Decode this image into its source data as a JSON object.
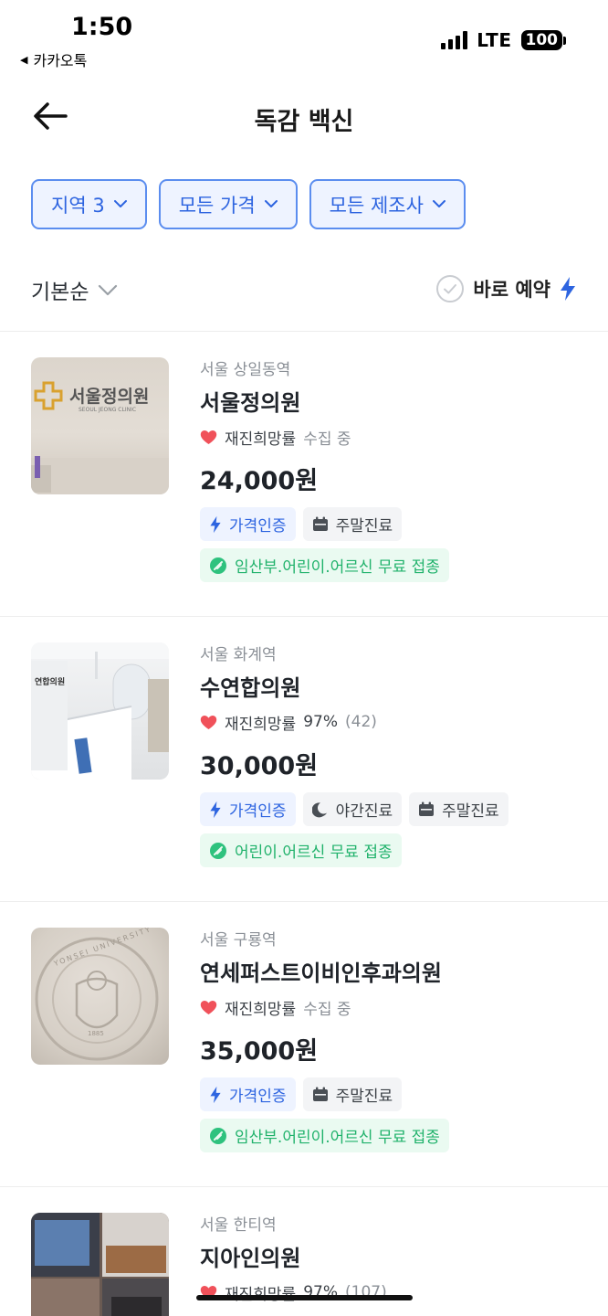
{
  "status": {
    "time": "1:50",
    "back_app": "카카오톡",
    "network": "LTE",
    "battery": "100"
  },
  "header": {
    "title": "독감 백신"
  },
  "filters": [
    {
      "label": "지역 3"
    },
    {
      "label": "모든 가격"
    },
    {
      "label": "모든 제조사"
    }
  ],
  "sort": {
    "label": "기본순",
    "instant_booking": "바로 예약"
  },
  "listings": [
    {
      "location": "서울 상일동역",
      "name": "서울정의원",
      "rating_label": "재진희망률",
      "rating_value": "수집 중",
      "rating_count": "",
      "price": "24,000원",
      "tags": [
        "가격인증",
        "주말진료"
      ],
      "free_tag": "임산부.어린이.어르신 무료 접종",
      "thumb_text": "서울정의원",
      "thumb_sub": "SEOUL JEONG CLINIC"
    },
    {
      "location": "서울 화계역",
      "name": "수연합의원",
      "rating_label": "재진희망률",
      "rating_value": "97%",
      "rating_count": "(42)",
      "price": "30,000원",
      "tags": [
        "가격인증",
        "야간진료",
        "주말진료"
      ],
      "free_tag": "어린이.어르신 무료 접종",
      "thumb_text": "연합의원"
    },
    {
      "location": "서울 구룡역",
      "name": "연세퍼스트이비인후과의원",
      "rating_label": "재진희망률",
      "rating_value": "수집 중",
      "rating_count": "",
      "price": "35,000원",
      "tags": [
        "가격인증",
        "주말진료"
      ],
      "free_tag": "임산부.어린이.어르신 무료 접종",
      "thumb_text": "YONSEI UNIVERSITY",
      "thumb_year": "1885"
    },
    {
      "location": "서울 한티역",
      "name": "지아인의원",
      "rating_label": "재진희망률",
      "rating_value": "97%",
      "rating_count": "(107)"
    }
  ],
  "colors": {
    "accent": "#2d64e0",
    "green": "#20b26b",
    "heart": "#f0515a"
  }
}
